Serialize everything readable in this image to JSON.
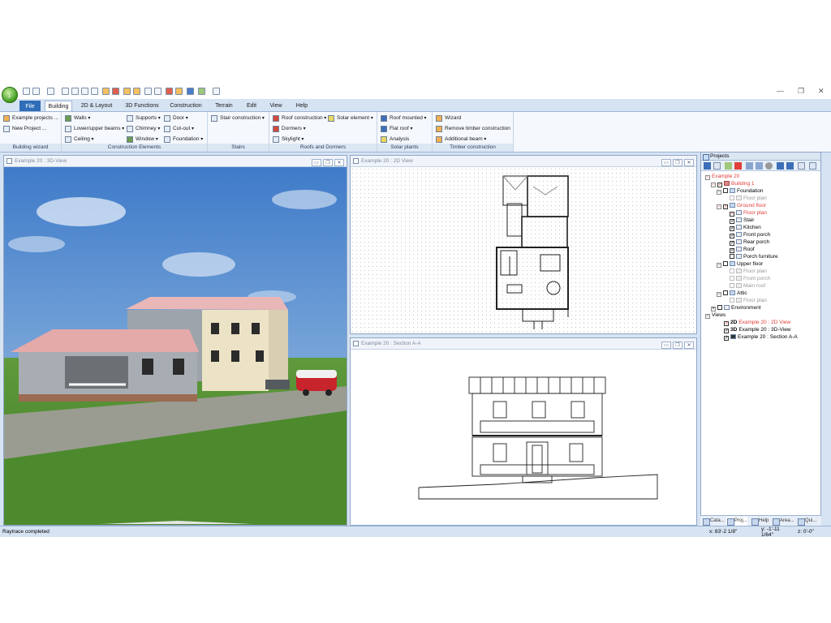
{
  "window": {
    "minimize": "—",
    "maximize": "❐",
    "close": "✕"
  },
  "menu": {
    "file": "File",
    "tabs": [
      "Building",
      "2D & Layout",
      "3D Functions",
      "Construction",
      "Terrain",
      "Edit",
      "View",
      "Help"
    ]
  },
  "ribbon": {
    "groups": {
      "building_wizard": "Building wizard",
      "construction_elements": "Construction Elements",
      "stairs": "Stairs",
      "roofs": "Roofs and Dormers",
      "solar": "Solar plants",
      "timber": "Timber construction"
    },
    "items": {
      "example_projects": "Example projects ...",
      "new_project": "New Project ...",
      "walls": "Walls",
      "lower_upper_beams": "Lower/upper beams",
      "ceiling": "Ceiling",
      "supports": "Supports",
      "chimney": "Chimney",
      "window": "Window",
      "door": "Door",
      "cutout": "Cut-out",
      "foundation": "Foundation",
      "stair_construction": "Stair construction",
      "roof_construction": "Roof construction",
      "dormers": "Dormers",
      "skylight": "Skylight",
      "solar_element": "Solar element",
      "roof_mounted": "Roof mounted",
      "flat_roof": "Flat roof",
      "analysis": "Analysis",
      "wizard": "Wizard",
      "remove_timber": "Remove timber construction",
      "additional_beam": "Additional beam"
    }
  },
  "views": {
    "view3d": "Example 20 : 3D-View",
    "view2d": "Example 20 : 2D View",
    "section": "Example 20 : Section A-A"
  },
  "pane_buttons": {
    "min": "▭",
    "restore": "❐",
    "close": "✕"
  },
  "projects": {
    "title": "Projects",
    "tree": {
      "root": "Example 20",
      "building": "Building 1",
      "foundation": "Foundation",
      "foundation_plan": "Floor plan",
      "ground_floor": "Ground floor",
      "ground_plan": "Floor plan",
      "stair": "Stair",
      "kitchen": "Kitchen",
      "front_porch": "Front porch",
      "rear_porch": "Rear porch",
      "roof": "Roof",
      "porch_furniture": "Porch furniture",
      "upper_floor": "Upper floor",
      "upper_plan": "Floor plan",
      "upper_front_porch": "Front porch",
      "main_roof": "Main roof",
      "attic": "Attic",
      "attic_plan": "Floor plan",
      "environment": "Environment",
      "views": "Views",
      "view_2d": "Example 20 : 2D View",
      "view_3d": "Example 20 : 3D-View",
      "view_section": "Example 20 : Section A-A",
      "badge_2d": "2D",
      "badge_3d": "3D"
    },
    "tabs": [
      "Cata...",
      "Proj...",
      "Help",
      "Area...",
      "Qui..."
    ]
  },
  "status": {
    "message": "Raytrace completed",
    "x": "x: 83'-2 1/8\"",
    "y": "y: -1'-11",
    "y2": "1/64\"",
    "z": "z: 0'-0\""
  },
  "colors": {
    "accent": "#2f6db8",
    "active_item": "#e0403a"
  }
}
